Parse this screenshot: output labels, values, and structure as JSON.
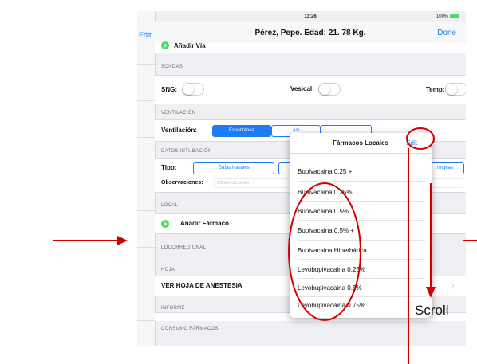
{
  "status_bar": {
    "time": "13:26",
    "battery": "100%"
  },
  "nav": {
    "back_label": "Edit",
    "title": "Pérez, Pepe. Edad: 21. 78 Kg.",
    "done_label": "Done"
  },
  "form": {
    "top_row_label": "Añadir Vía",
    "sondas": {
      "header": "SONDAS",
      "sng": "SNG:",
      "vesical": "Vesical:",
      "temp": "Temp:"
    },
    "ventilacion": {
      "header": "VENTILACIÓN",
      "label": "Ventilación:",
      "options": [
        "Espontánea",
        "Asi"
      ]
    },
    "intubacion": {
      "header": "DATOS INTUBACIÓN",
      "tipo_label": "Tipo:",
      "tipo_option": "Gafas Nasales",
      "tipo_option_right": "ríngeas",
      "obs_label": "Observaciones:",
      "obs_placeholder": "Observaciones"
    },
    "local": {
      "header": "LOCAL",
      "add_label": "Añadir Fármaco"
    },
    "locorregional": {
      "header": "LOCORREGIONAL"
    },
    "hoja": {
      "header": "HOJA",
      "link": "VER HOJA DE ANESTESIA"
    },
    "informe": {
      "header": "INFORME"
    },
    "consumo": {
      "header": "CONSUMO FÁRMACOS"
    }
  },
  "popover": {
    "title": "Fármacos Locales",
    "edit_label": "Edit",
    "items": [
      "Bupivacaina 0.25 +",
      "Bupivacaina 0.25%",
      "Bupivacaina 0.5%",
      "Bupivacaina 0.5% +",
      "Bupivacaina Hiperbárica",
      "Levobupivacaina 0.25%",
      "Levobupivacaina 0.5%",
      "Levobupivacaina 0.75%"
    ]
  },
  "annotation": {
    "scroll_label": "Scroll",
    "color": "#d40000"
  },
  "colors": {
    "accent": "#1d7cf2",
    "green": "#4cd964"
  }
}
